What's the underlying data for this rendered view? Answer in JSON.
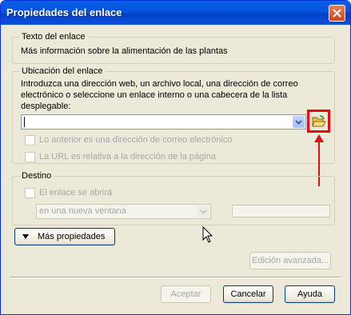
{
  "window": {
    "title": "Propiedades del enlace"
  },
  "link_text": {
    "group_label": "Texto del enlace",
    "value": "Más información sobre la alimentación de las plantas"
  },
  "location": {
    "group_label": "Ubicación del enlace",
    "instructions": [
      "Introduzca una dirección web, un archivo local, una dirección de correo",
      "electrónico o seleccione un enlace interno o una cabecera de la lista",
      "desplegable:"
    ],
    "url_value": "",
    "email_checkbox_label": "Lo anterior es una dirección de correo electrónico",
    "relative_checkbox_label": "La URL es relativa a la dirección de la página"
  },
  "target": {
    "group_label": "Destino",
    "open_checkbox_label": "El enlace se abrirá",
    "window_select_value": "en una nueva ventana",
    "frame_name_value": ""
  },
  "more_properties_label": "Más propiedades",
  "advanced_edit_label": "Edición avanzada...",
  "buttons": {
    "accept": "Aceptar",
    "cancel": "Cancelar",
    "help": "Ayuda"
  },
  "colors": {
    "title_bar": "#0454dc",
    "annotation": "#e01010",
    "dialog_bg": "#ece9d8"
  }
}
